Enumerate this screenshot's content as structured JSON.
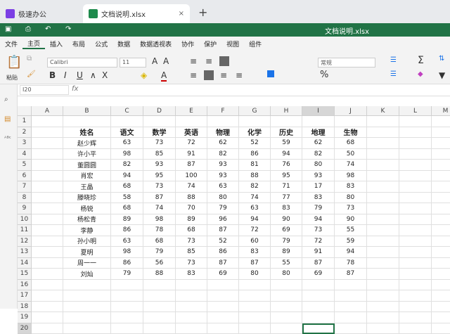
{
  "tabs": {
    "app": "极速办公",
    "file": "文档说明.xlsx",
    "close": "×",
    "new": "+"
  },
  "title": "文档说明.xlsx",
  "menu": [
    "文件",
    "主页",
    "插入",
    "布局",
    "公式",
    "数据",
    "数据透视表",
    "协作",
    "保护",
    "视图",
    "组件"
  ],
  "ribbon": {
    "paste": "粘贴",
    "font": "Calibri",
    "size": "11",
    "number_format": "常规",
    "grow": "A",
    "shrink": "A",
    "bold": "B",
    "italic": "I",
    "underline": "U",
    "strike": "∧",
    "sub": "X",
    "percent": "%",
    "sum": "Σ"
  },
  "formula": {
    "cell_ref": "I20",
    "fx": "fx",
    "value": ""
  },
  "columns": [
    "A",
    "B",
    "C",
    "D",
    "E",
    "F",
    "G",
    "H",
    "I",
    "J",
    "K",
    "L",
    "M"
  ],
  "selected_cell": "I20",
  "headers": [
    "姓名",
    "语文",
    "数学",
    "英语",
    "物理",
    "化学",
    "历史",
    "地理",
    "生物"
  ],
  "rows": [
    [
      "赵少辉",
      63,
      73,
      72,
      62,
      52,
      59,
      62,
      68
    ],
    [
      "许小平",
      98,
      85,
      91,
      82,
      86,
      94,
      82,
      50
    ],
    [
      "董圆圆",
      82,
      93,
      87,
      93,
      81,
      76,
      80,
      74
    ],
    [
      "肖宏",
      94,
      95,
      100,
      93,
      88,
      95,
      93,
      98
    ],
    [
      "王晶",
      68,
      73,
      74,
      63,
      82,
      71,
      17,
      83
    ],
    [
      "滕晓珍",
      58,
      87,
      88,
      80,
      74,
      77,
      83,
      80
    ],
    [
      "杨锐",
      68,
      74,
      70,
      79,
      63,
      83,
      79,
      73
    ],
    [
      "杨松青",
      89,
      98,
      89,
      96,
      94,
      90,
      94,
      90
    ],
    [
      "李静",
      86,
      78,
      68,
      87,
      72,
      69,
      73,
      55
    ],
    [
      "孙小明",
      63,
      68,
      73,
      52,
      60,
      79,
      72,
      59
    ],
    [
      "夏明",
      98,
      79,
      85,
      86,
      83,
      89,
      91,
      94
    ],
    [
      "周一一",
      86,
      56,
      73,
      87,
      87,
      55,
      87,
      78
    ],
    [
      "刘灿",
      79,
      88,
      83,
      69,
      80,
      80,
      69,
      87
    ]
  ],
  "row_count": 20
}
